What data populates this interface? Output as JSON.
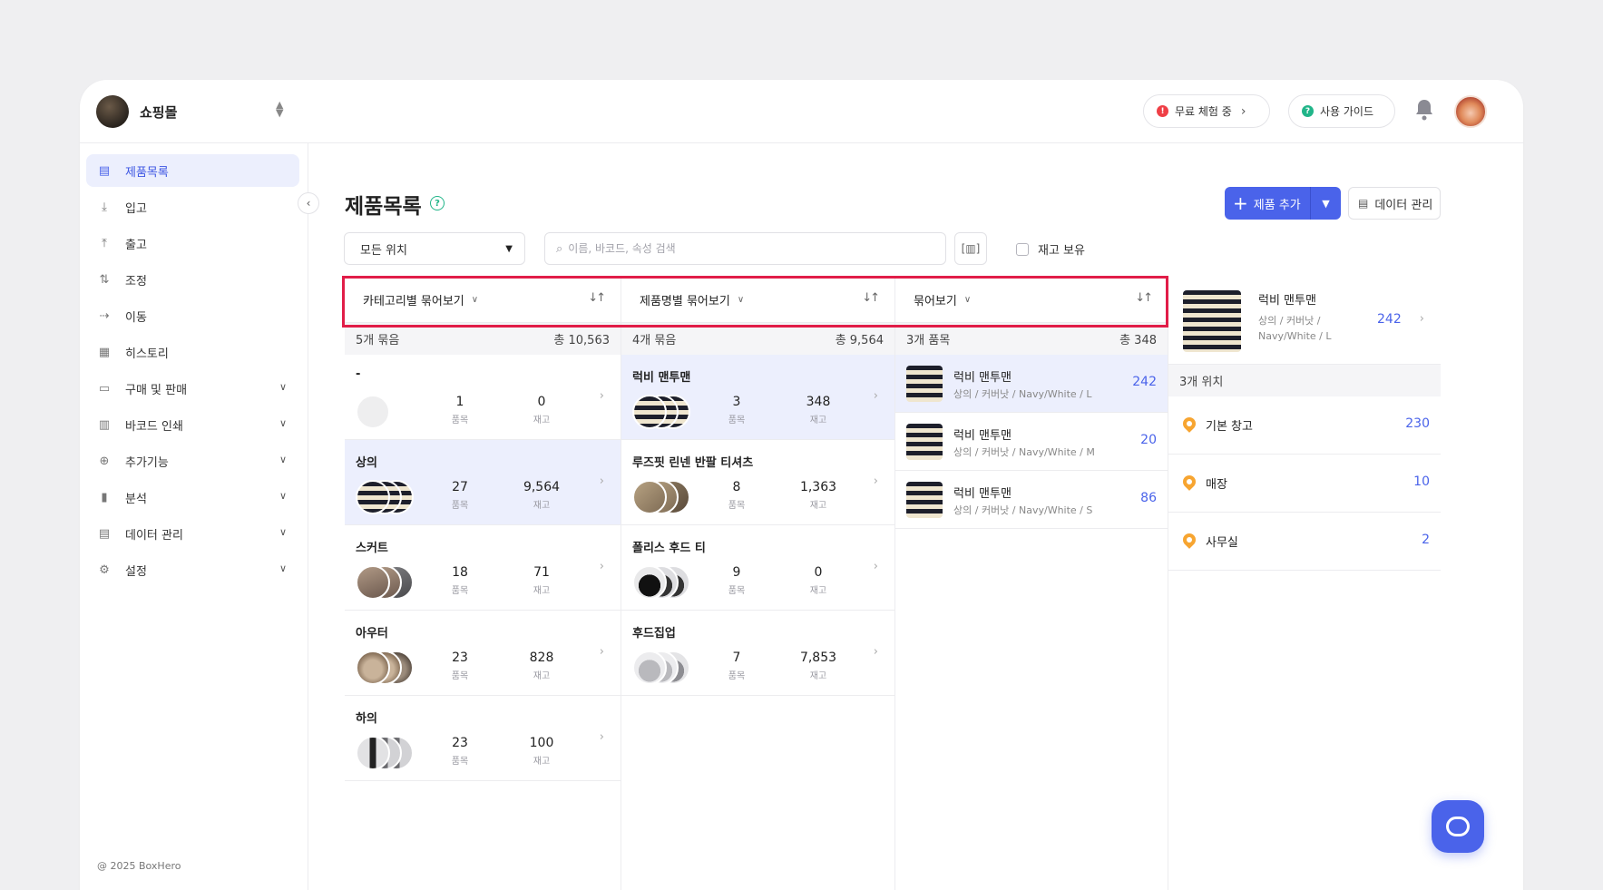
{
  "store": {
    "name": "쇼핑몰"
  },
  "topbar": {
    "trial_label": "무료 체험 중",
    "guide_label": "사용 가이드"
  },
  "sidebar": {
    "items": [
      {
        "label": "제품목록",
        "icon": "box-icon"
      },
      {
        "label": "입고",
        "icon": "arrow-down-icon"
      },
      {
        "label": "출고",
        "icon": "arrow-up-icon"
      },
      {
        "label": "조정",
        "icon": "adjust-icon"
      },
      {
        "label": "이동",
        "icon": "move-icon"
      },
      {
        "label": "히스토리",
        "icon": "history-icon"
      },
      {
        "label": "구매 및 판매",
        "icon": "document-icon"
      },
      {
        "label": "바코드 인쇄",
        "icon": "barcode-icon"
      },
      {
        "label": "추가기능",
        "icon": "plus-circle-icon"
      },
      {
        "label": "분석",
        "icon": "chart-icon"
      },
      {
        "label": "데이터 관리",
        "icon": "database-icon"
      },
      {
        "label": "설정",
        "icon": "gear-icon"
      }
    ],
    "copyright": "@ 2025 BoxHero"
  },
  "page": {
    "title": "제품목록",
    "add_label": "제품 추가",
    "data_label": "데이터 관리",
    "location_select": "모든 위치",
    "search_placeholder": "이름, 바코드, 속성 검색",
    "stock_filter_label": "재고 보유"
  },
  "columns": {
    "category": {
      "header": "카테고리별 묶어보기",
      "summary_left": "5개 묶음",
      "summary_right": "총 10,563",
      "rows": [
        {
          "name": "-",
          "items": "1",
          "stock": "0",
          "items_label": "품목",
          "stock_label": "재고"
        },
        {
          "name": "상의",
          "items": "27",
          "stock": "9,564",
          "items_label": "품목",
          "stock_label": "재고"
        },
        {
          "name": "스커트",
          "items": "18",
          "stock": "71",
          "items_label": "품목",
          "stock_label": "재고"
        },
        {
          "name": "아우터",
          "items": "23",
          "stock": "828",
          "items_label": "품목",
          "stock_label": "재고"
        },
        {
          "name": "하의",
          "items": "23",
          "stock": "100",
          "items_label": "품목",
          "stock_label": "재고"
        }
      ]
    },
    "product": {
      "header": "제품명별 묶어보기",
      "summary_left": "4개 묶음",
      "summary_right": "총 9,564",
      "rows": [
        {
          "name": "럭비 맨투맨",
          "items": "3",
          "stock": "348",
          "items_label": "품목",
          "stock_label": "재고"
        },
        {
          "name": "루즈핏 린넨 반팔 티셔츠",
          "items": "8",
          "stock": "1,363",
          "items_label": "품목",
          "stock_label": "재고"
        },
        {
          "name": "폴리스 후드 티",
          "items": "9",
          "stock": "0",
          "items_label": "품목",
          "stock_label": "재고"
        },
        {
          "name": "후드집업",
          "items": "7",
          "stock": "7,853",
          "items_label": "품목",
          "stock_label": "재고"
        }
      ]
    },
    "items": {
      "header": "묶어보기",
      "summary_left": "3개 품목",
      "summary_right": "총 348",
      "rows": [
        {
          "name": "럭비 맨투맨",
          "variant": "상의 / 커버낫 / Navy/White / L",
          "qty": "242"
        },
        {
          "name": "럭비 맨투맨",
          "variant": "상의 / 커버낫 / Navy/White / M",
          "qty": "20"
        },
        {
          "name": "럭비 맨투맨",
          "variant": "상의 / 커버낫 / Navy/White / S",
          "qty": "86"
        }
      ]
    }
  },
  "detail": {
    "name": "럭비 맨투맨",
    "variant": "상의 / 커버낫 / Navy/White / L",
    "qty": "242",
    "locations_summary": "3개 위치",
    "locations": [
      {
        "name": "기본 창고",
        "qty": "230"
      },
      {
        "name": "매장",
        "qty": "10"
      },
      {
        "name": "사무실",
        "qty": "2"
      }
    ]
  },
  "colors": {
    "accent": "#4a63ea",
    "highlight_border": "#e11d48",
    "pin": "#f7a531"
  }
}
